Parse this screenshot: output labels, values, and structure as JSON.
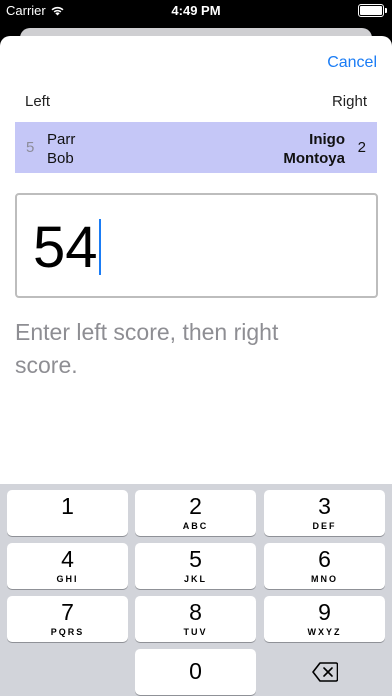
{
  "status_bar": {
    "carrier": "Carrier",
    "time": "4:49 PM"
  },
  "sheet": {
    "cancel_label": "Cancel",
    "left_label": "Left",
    "right_label": "Right"
  },
  "match": {
    "left_seed": "5",
    "left_first": "Parr",
    "left_last": "Bob",
    "right_first": "Inigo",
    "right_last": "Montoya",
    "right_seed": "2",
    "highlight_color": "#c5c7f7"
  },
  "score_input": {
    "value": "54"
  },
  "hint": "Enter left score, then right score.",
  "keypad": {
    "keys": [
      {
        "digit": "1",
        "letters": ""
      },
      {
        "digit": "2",
        "letters": "ABC"
      },
      {
        "digit": "3",
        "letters": "DEF"
      },
      {
        "digit": "4",
        "letters": "GHI"
      },
      {
        "digit": "5",
        "letters": "JKL"
      },
      {
        "digit": "6",
        "letters": "MNO"
      },
      {
        "digit": "7",
        "letters": "PQRS"
      },
      {
        "digit": "8",
        "letters": "TUV"
      },
      {
        "digit": "9",
        "letters": "WXYZ"
      },
      {
        "digit": "0",
        "letters": ""
      }
    ],
    "delete_icon": "backspace-icon"
  },
  "colors": {
    "accent": "#1a7cf5"
  }
}
